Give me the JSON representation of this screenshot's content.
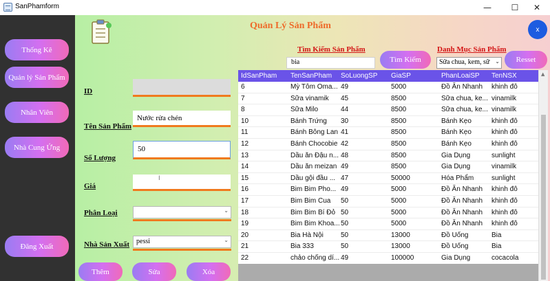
{
  "window": {
    "title": "SanPhamform",
    "min": "—",
    "max": "☐",
    "close": "✕"
  },
  "sidebar": {
    "items": [
      {
        "label": "Thống Kê"
      },
      {
        "label": "Quản lý Sản Phẩm"
      },
      {
        "label": "Nhân Viên"
      },
      {
        "label": "Nhà Cung Ứng"
      }
    ],
    "logout": "Đăng Xuất"
  },
  "header": {
    "title": "Quản Lý Sản Phẩm",
    "close": "x"
  },
  "form": {
    "id_label": "ID",
    "id_value": "",
    "name_label": "Tên Sản Phẩm",
    "name_value": "Nước rửa chén",
    "qty_label": "Số Lượng",
    "qty_value": "50",
    "price_label": "Giá",
    "price_value": "",
    "category_label": "Phân Loại",
    "category_value": "",
    "maker_label": "Nhà Sản Xuất",
    "maker_value": "pessi"
  },
  "actions": {
    "add": "Thêm",
    "edit": "Sửa",
    "delete": "Xóa"
  },
  "search": {
    "label": "Tìm Kiếm Sản Phẩm",
    "value": "bia",
    "button": "Tìm Kiếm",
    "category_label": "Danh Mục Sản Phẩm",
    "category_value": "Sữa chua, kem, sữ",
    "reset": "Resset"
  },
  "grid": {
    "columns": [
      "IdSanPham",
      "TenSanPham",
      "SoLuongSP",
      "GiaSP",
      "PhanLoaiSP",
      "TenNSX"
    ],
    "rows": [
      [
        "6",
        "Mỳ Tôm Oma...",
        "49",
        "5000",
        "Đồ Ăn Nhanh",
        "khinh đô"
      ],
      [
        "7",
        "Sữa vinamik",
        "45",
        "8500",
        "Sữa chua, ke...",
        "vinamilk"
      ],
      [
        "8",
        "Sữa Milo",
        "44",
        "8500",
        "Sữa chua, ke...",
        "vinamilk"
      ],
      [
        "10",
        "Bánh Trứng",
        "30",
        "8500",
        "Bánh Kẹo",
        "khinh đô"
      ],
      [
        "11",
        "Bánh Bông Lan",
        "41",
        "8500",
        "Bánh Kẹo",
        "khinh đô"
      ],
      [
        "12",
        "Bánh Chocobie",
        "42",
        "8500",
        "Bánh Kẹo",
        "khinh đô"
      ],
      [
        "13",
        "Dầu ăn Đậu n...",
        "48",
        "8500",
        "Gia Dụng",
        "sunlight"
      ],
      [
        "14",
        "Dầu ăn meizan",
        "49",
        "8500",
        "Gia Dụng",
        "vinamilk"
      ],
      [
        "15",
        "Dầu gội đầu ...",
        "47",
        "50000",
        "Hóa Phẩm",
        "sunlight"
      ],
      [
        "16",
        "Bim Bim Pho...",
        "49",
        "5000",
        "Đồ Ăn Nhanh",
        "khinh đô"
      ],
      [
        "17",
        "Bim Bim Cua",
        "50",
        "5000",
        "Đồ Ăn Nhanh",
        "khinh đô"
      ],
      [
        "18",
        "Bim Bim Bí Đỏ",
        "50",
        "5000",
        "Đồ Ăn Nhanh",
        "khinh đô"
      ],
      [
        "19",
        "Bim Bim Khoa...",
        "50",
        "5000",
        "Đồ Ăn Nhanh",
        "khinh đô"
      ],
      [
        "20",
        "Bia Hà Nội",
        "50",
        "13000",
        "Đồ Uống",
        "Bia"
      ],
      [
        "21",
        "Bia 333",
        "50",
        "13000",
        "Đồ Uống",
        "Bia"
      ],
      [
        "22",
        "chảo chống dí...",
        "49",
        "100000",
        "Gia Dụng",
        "cocacola"
      ]
    ]
  },
  "colors": {
    "accent": "#6a53e8",
    "title": "#ee6a2a",
    "label_red": "#d31414",
    "close_blue": "#1d5ce0"
  }
}
